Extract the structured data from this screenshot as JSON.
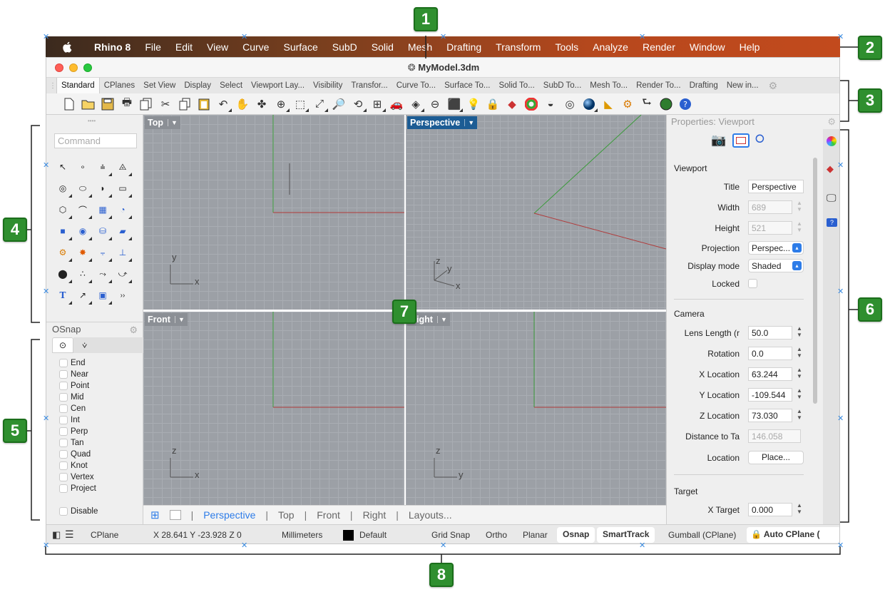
{
  "menubar": {
    "app": "Rhino 8",
    "items": [
      "File",
      "Edit",
      "View",
      "Curve",
      "Surface",
      "SubD",
      "Solid",
      "Mesh",
      "Drafting",
      "Transform",
      "Tools",
      "Analyze",
      "Render",
      "Window",
      "Help"
    ]
  },
  "window": {
    "title": "MyModel.3dm"
  },
  "toolbar_tabs": [
    "Standard",
    "CPlanes",
    "Set View",
    "Display",
    "Select",
    "Viewport Lay...",
    "Visibility",
    "Transfor...",
    "Curve To...",
    "Surface To...",
    "Solid To...",
    "SubD To...",
    "Mesh To...",
    "Render To...",
    "Drafting",
    "New in..."
  ],
  "command": {
    "placeholder": "Command"
  },
  "osnap": {
    "title": "OSnap",
    "items": [
      "End",
      "Near",
      "Point",
      "Mid",
      "Cen",
      "Int",
      "Perp",
      "Tan",
      "Quad",
      "Knot",
      "Vertex",
      "Project"
    ],
    "disable": "Disable"
  },
  "viewports": [
    {
      "name": "Top",
      "axes": [
        "y",
        "x"
      ]
    },
    {
      "name": "Perspective",
      "axes": [
        "z",
        "y",
        "x"
      ]
    },
    {
      "name": "Front",
      "axes": [
        "z",
        "x"
      ]
    },
    {
      "name": "Right",
      "axes": [
        "z",
        "y"
      ]
    }
  ],
  "viewport_tabs": [
    "Perspective",
    "Top",
    "Front",
    "Right",
    "Layouts..."
  ],
  "properties": {
    "title": "Properties: Viewport",
    "viewport_section": "Viewport",
    "title_label": "Title",
    "title_value": "Perspective",
    "width_label": "Width",
    "width_value": "689",
    "height_label": "Height",
    "height_value": "521",
    "projection_label": "Projection",
    "projection_value": "Perspec...",
    "display_mode_label": "Display mode",
    "display_mode_value": "Shaded",
    "locked_label": "Locked",
    "camera_section": "Camera",
    "lens_label": "Lens Length (r",
    "lens_value": "50.0",
    "rotation_label": "Rotation",
    "rotation_value": "0.0",
    "xloc_label": "X Location",
    "xloc_value": "63.244",
    "yloc_label": "Y Location",
    "yloc_value": "-109.544",
    "zloc_label": "Z Location",
    "zloc_value": "73.030",
    "dist_label": "Distance to Ta",
    "dist_value": "146.058",
    "location_label": "Location",
    "location_button": "Place...",
    "target_section": "Target",
    "xtarget_label": "X Target",
    "xtarget_value": "0.000"
  },
  "status": {
    "cplane": "CPlane",
    "coords": "X 28.641 Y -23.928 Z 0",
    "units": "Millimeters",
    "layer": "Default",
    "grid_snap": "Grid Snap",
    "ortho": "Ortho",
    "planar": "Planar",
    "osnap": "Osnap",
    "smarttrack": "SmartTrack",
    "gumball": "Gumball (CPlane)",
    "auto_cplane": "Auto CPlane ("
  },
  "callouts": [
    "1",
    "2",
    "3",
    "4",
    "5",
    "6",
    "7",
    "8"
  ],
  "colors": {
    "accent": "#1c5c94",
    "callout": "#2f8f2f",
    "menubar_end": "#c24a1d",
    "x_axis": "#b03a3a",
    "y_axis": "#3a9a3a"
  }
}
